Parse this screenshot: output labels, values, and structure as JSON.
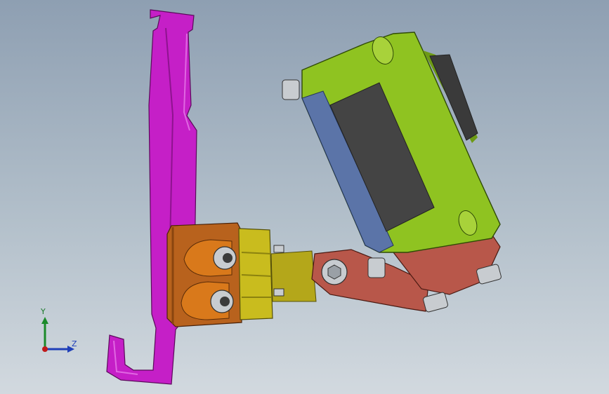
{
  "view": {
    "triad": {
      "y_label": "Y",
      "z_label": "Z"
    }
  },
  "colors": {
    "background_top": "#8e9fb2",
    "background_bottom": "#d2d9df",
    "bracket": "#c51fc7",
    "clamp_block": "#b8621d",
    "fitting": "#c9bc1e",
    "link": "#b8574a",
    "housing": "#8fc321",
    "housing_edge": "#5b74a8",
    "window": "#444444",
    "bolt": "#c8ccd0",
    "triad_x": "#c01b1b",
    "triad_y": "#1b8a2a",
    "triad_z": "#1f3fb8"
  }
}
